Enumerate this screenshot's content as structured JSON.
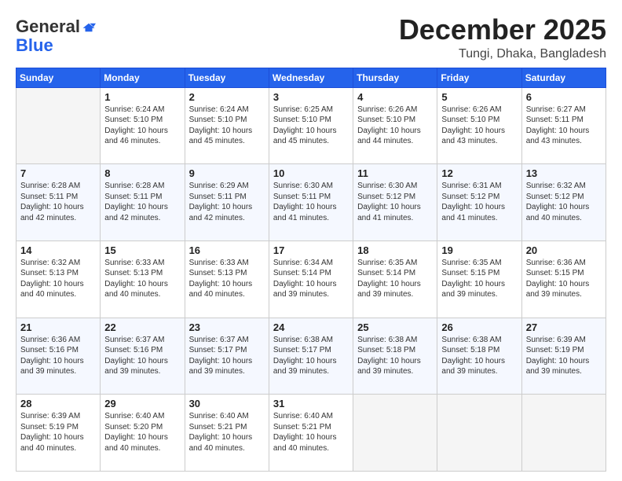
{
  "logo": {
    "general": "General",
    "blue": "Blue"
  },
  "header": {
    "month": "December 2025",
    "location": "Tungi, Dhaka, Bangladesh"
  },
  "weekdays": [
    "Sunday",
    "Monday",
    "Tuesday",
    "Wednesday",
    "Thursday",
    "Friday",
    "Saturday"
  ],
  "weeks": [
    [
      {
        "day": "",
        "info": ""
      },
      {
        "day": "1",
        "info": "Sunrise: 6:24 AM\nSunset: 5:10 PM\nDaylight: 10 hours\nand 46 minutes."
      },
      {
        "day": "2",
        "info": "Sunrise: 6:24 AM\nSunset: 5:10 PM\nDaylight: 10 hours\nand 45 minutes."
      },
      {
        "day": "3",
        "info": "Sunrise: 6:25 AM\nSunset: 5:10 PM\nDaylight: 10 hours\nand 45 minutes."
      },
      {
        "day": "4",
        "info": "Sunrise: 6:26 AM\nSunset: 5:10 PM\nDaylight: 10 hours\nand 44 minutes."
      },
      {
        "day": "5",
        "info": "Sunrise: 6:26 AM\nSunset: 5:10 PM\nDaylight: 10 hours\nand 43 minutes."
      },
      {
        "day": "6",
        "info": "Sunrise: 6:27 AM\nSunset: 5:11 PM\nDaylight: 10 hours\nand 43 minutes."
      }
    ],
    [
      {
        "day": "7",
        "info": "Sunrise: 6:28 AM\nSunset: 5:11 PM\nDaylight: 10 hours\nand 42 minutes."
      },
      {
        "day": "8",
        "info": "Sunrise: 6:28 AM\nSunset: 5:11 PM\nDaylight: 10 hours\nand 42 minutes."
      },
      {
        "day": "9",
        "info": "Sunrise: 6:29 AM\nSunset: 5:11 PM\nDaylight: 10 hours\nand 42 minutes."
      },
      {
        "day": "10",
        "info": "Sunrise: 6:30 AM\nSunset: 5:11 PM\nDaylight: 10 hours\nand 41 minutes."
      },
      {
        "day": "11",
        "info": "Sunrise: 6:30 AM\nSunset: 5:12 PM\nDaylight: 10 hours\nand 41 minutes."
      },
      {
        "day": "12",
        "info": "Sunrise: 6:31 AM\nSunset: 5:12 PM\nDaylight: 10 hours\nand 41 minutes."
      },
      {
        "day": "13",
        "info": "Sunrise: 6:32 AM\nSunset: 5:12 PM\nDaylight: 10 hours\nand 40 minutes."
      }
    ],
    [
      {
        "day": "14",
        "info": "Sunrise: 6:32 AM\nSunset: 5:13 PM\nDaylight: 10 hours\nand 40 minutes."
      },
      {
        "day": "15",
        "info": "Sunrise: 6:33 AM\nSunset: 5:13 PM\nDaylight: 10 hours\nand 40 minutes."
      },
      {
        "day": "16",
        "info": "Sunrise: 6:33 AM\nSunset: 5:13 PM\nDaylight: 10 hours\nand 40 minutes."
      },
      {
        "day": "17",
        "info": "Sunrise: 6:34 AM\nSunset: 5:14 PM\nDaylight: 10 hours\nand 39 minutes."
      },
      {
        "day": "18",
        "info": "Sunrise: 6:35 AM\nSunset: 5:14 PM\nDaylight: 10 hours\nand 39 minutes."
      },
      {
        "day": "19",
        "info": "Sunrise: 6:35 AM\nSunset: 5:15 PM\nDaylight: 10 hours\nand 39 minutes."
      },
      {
        "day": "20",
        "info": "Sunrise: 6:36 AM\nSunset: 5:15 PM\nDaylight: 10 hours\nand 39 minutes."
      }
    ],
    [
      {
        "day": "21",
        "info": "Sunrise: 6:36 AM\nSunset: 5:16 PM\nDaylight: 10 hours\nand 39 minutes."
      },
      {
        "day": "22",
        "info": "Sunrise: 6:37 AM\nSunset: 5:16 PM\nDaylight: 10 hours\nand 39 minutes."
      },
      {
        "day": "23",
        "info": "Sunrise: 6:37 AM\nSunset: 5:17 PM\nDaylight: 10 hours\nand 39 minutes."
      },
      {
        "day": "24",
        "info": "Sunrise: 6:38 AM\nSunset: 5:17 PM\nDaylight: 10 hours\nand 39 minutes."
      },
      {
        "day": "25",
        "info": "Sunrise: 6:38 AM\nSunset: 5:18 PM\nDaylight: 10 hours\nand 39 minutes."
      },
      {
        "day": "26",
        "info": "Sunrise: 6:38 AM\nSunset: 5:18 PM\nDaylight: 10 hours\nand 39 minutes."
      },
      {
        "day": "27",
        "info": "Sunrise: 6:39 AM\nSunset: 5:19 PM\nDaylight: 10 hours\nand 39 minutes."
      }
    ],
    [
      {
        "day": "28",
        "info": "Sunrise: 6:39 AM\nSunset: 5:19 PM\nDaylight: 10 hours\nand 40 minutes."
      },
      {
        "day": "29",
        "info": "Sunrise: 6:40 AM\nSunset: 5:20 PM\nDaylight: 10 hours\nand 40 minutes."
      },
      {
        "day": "30",
        "info": "Sunrise: 6:40 AM\nSunset: 5:21 PM\nDaylight: 10 hours\nand 40 minutes."
      },
      {
        "day": "31",
        "info": "Sunrise: 6:40 AM\nSunset: 5:21 PM\nDaylight: 10 hours\nand 40 minutes."
      },
      {
        "day": "",
        "info": ""
      },
      {
        "day": "",
        "info": ""
      },
      {
        "day": "",
        "info": ""
      }
    ]
  ]
}
